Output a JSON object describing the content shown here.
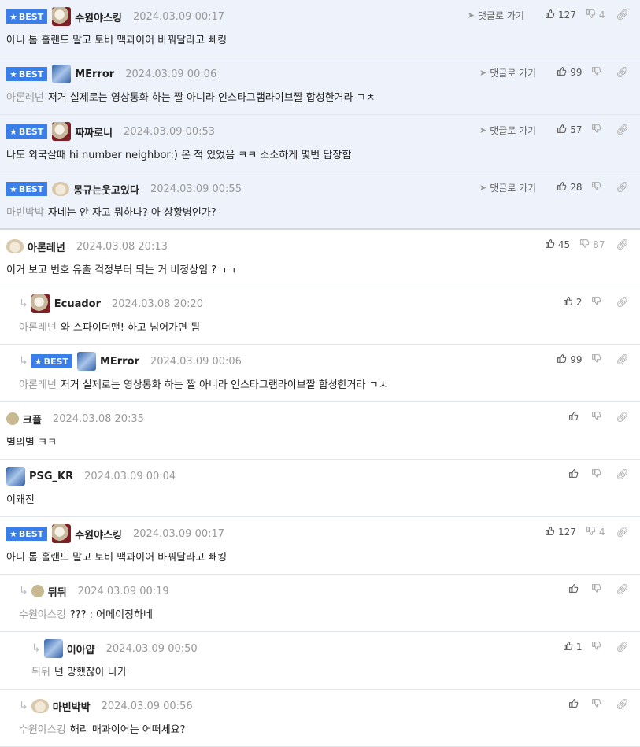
{
  "labels": {
    "best": "BEST",
    "reply_link": "댓글로 가기"
  },
  "comments": [
    {
      "best": true,
      "bg": true,
      "indent": 0,
      "avatar": "seal",
      "author": "수원야스킹",
      "date": "2024.03.09 00:17",
      "reply_link": true,
      "up": "127",
      "down": "4",
      "mention": "",
      "text": "아니 톰 홀랜드 말고 토비 맥과이어 바꿔달라고 빼킹"
    },
    {
      "best": true,
      "bg": true,
      "indent": 0,
      "avatar": "blue",
      "author": "MError",
      "date": "2024.03.09 00:06",
      "reply_link": true,
      "up": "99",
      "down": "",
      "mention": "아론레넌",
      "text": "저거 실제로는 영상통화 하는 짤 아니라 인스타그램라이브짤 합성한거라 ㄱㅊ"
    },
    {
      "best": true,
      "bg": true,
      "indent": 0,
      "avatar": "seal",
      "author": "짜짜로니",
      "date": "2024.03.09 00:53",
      "reply_link": true,
      "up": "57",
      "down": "",
      "mention": "",
      "text": "나도 외국살때 hi number neighbor:) 온 적 있었음 ㅋㅋ 소소하게 몇번 답장함"
    },
    {
      "best": true,
      "bg": true,
      "indent": 0,
      "avatar": "puppy",
      "author": "몽규는웃고있다",
      "date": "2024.03.09 00:55",
      "reply_link": true,
      "up": "28",
      "down": "",
      "mention": "마빈박박",
      "text": "자네는 안 자고 뭐하나? 아 상황병인가?"
    },
    {
      "best": false,
      "bg": false,
      "indent": 0,
      "avatar": "puppy",
      "author": "아론레넌",
      "date": "2024.03.08 20:13",
      "reply_link": false,
      "up": "45",
      "down": "87",
      "mention": "",
      "text": "이거 보고 번호 유출 걱정부터 되는 거 비정상임 ? ㅜㅜ"
    },
    {
      "best": false,
      "bg": false,
      "indent": 1,
      "avatar": "seal",
      "author": "Ecuador",
      "date": "2024.03.08 20:20",
      "reply_link": false,
      "up": "2",
      "down": "",
      "mention": "아론레넌",
      "text": "와 스파이더맨! 하고 넘어가면 됨"
    },
    {
      "best": true,
      "bg": false,
      "indent": 1,
      "avatar": "blue",
      "author": "MError",
      "date": "2024.03.09 00:06",
      "reply_link": false,
      "up": "99",
      "down": "",
      "mention": "아론레넌",
      "text": "저거 실제로는 영상통화 하는 짤 아니라 인스타그램라이브짤 합성한거라 ㄱㅊ"
    },
    {
      "best": false,
      "bg": false,
      "indent": 0,
      "avatar": "dot",
      "author": "크플",
      "date": "2024.03.08 20:35",
      "reply_link": false,
      "up": "",
      "down": "",
      "mention": "",
      "text": "별의별 ㅋㅋ"
    },
    {
      "best": false,
      "bg": false,
      "indent": 0,
      "avatar": "blue",
      "author": "PSG_KR",
      "date": "2024.03.09 00:04",
      "reply_link": false,
      "up": "",
      "down": "",
      "mention": "",
      "text": "이왜진"
    },
    {
      "best": true,
      "bg": false,
      "indent": 0,
      "avatar": "seal",
      "author": "수원야스킹",
      "date": "2024.03.09 00:17",
      "reply_link": false,
      "up": "127",
      "down": "4",
      "mention": "",
      "text": "아니 톰 홀랜드 말고 토비 맥과이어 바꿔달라고 빼킹"
    },
    {
      "best": false,
      "bg": false,
      "indent": 1,
      "avatar": "dot",
      "author": "뒤뒤",
      "date": "2024.03.09 00:19",
      "reply_link": false,
      "up": "",
      "down": "",
      "mention": "수원야스킹",
      "text": "??? : 어메이징하네"
    },
    {
      "best": false,
      "bg": false,
      "indent": 2,
      "avatar": "blue",
      "author": "이아얍",
      "date": "2024.03.09 00:50",
      "reply_link": false,
      "up": "1",
      "down": "",
      "mention": "뒤뒤",
      "text": "넌 망했잖아 나가"
    },
    {
      "best": false,
      "bg": false,
      "indent": 1,
      "avatar": "puppy",
      "author": "마빈박박",
      "date": "2024.03.09 00:56",
      "reply_link": false,
      "up": "",
      "down": "",
      "mention": "수원야스킹",
      "text": "해리 매과이어는 어떠세요?"
    }
  ]
}
